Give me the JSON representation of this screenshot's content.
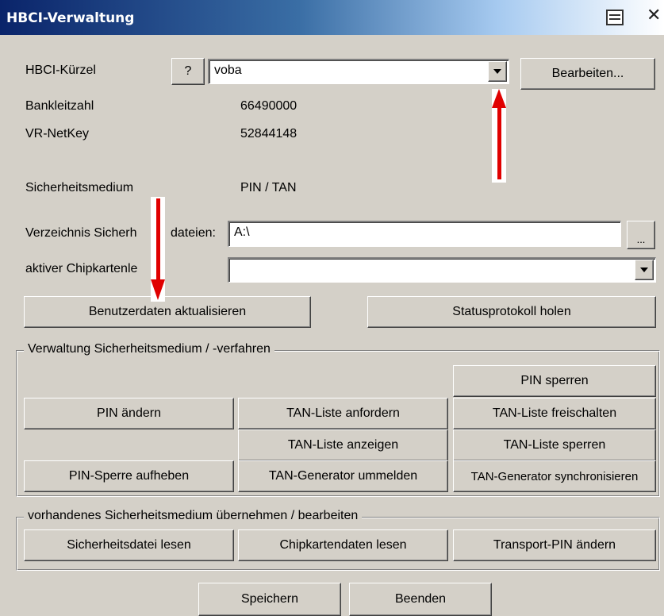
{
  "window": {
    "title": "HBCI-Verwaltung"
  },
  "account": {
    "kuerzel_label": "HBCI-Kürzel",
    "help_label": "?",
    "kuerzel_value": "voba",
    "edit_button": "Bearbeiten...",
    "blz_label": "Bankleitzahl",
    "blz_value": "66490000",
    "netkey_label": "VR-NetKey",
    "netkey_value": "52844148",
    "medium_label": "Sicherheitsmedium",
    "medium_value": "PIN / TAN",
    "dir_label_a": "Verzeichnis Sicherh",
    "dir_label_b": "dateien:",
    "dir_value": "A:\\",
    "browse_label": "...",
    "chip_label": "aktiver Chipkartenle",
    "chip_value": ""
  },
  "actions": {
    "update_user": "Benutzerdaten aktualisieren",
    "status_log": "Statusprotokoll holen"
  },
  "group_medium": {
    "title": "Verwaltung Sicherheitsmedium / -verfahren",
    "pin_sperren": "PIN sperren",
    "pin_aendern": "PIN ändern",
    "tan_anfordern": "TAN-Liste anfordern",
    "tan_freischalten": "TAN-Liste freischalten",
    "tan_anzeigen": "TAN-Liste anzeigen",
    "tan_sperren": "TAN-Liste sperren",
    "pin_sperre_aufheben": "PIN-Sperre aufheben",
    "gen_ummelden": "TAN-Generator ummelden",
    "gen_sync": "TAN-Generator synchronisieren"
  },
  "group_existing": {
    "title": "vorhandenes Sicherheitsmedium übernehmen / bearbeiten",
    "read_file": "Sicherheitsdatei lesen",
    "read_chip": "Chipkartendaten lesen",
    "transport_pin": "Transport-PIN ändern"
  },
  "footer": {
    "save": "Speichern",
    "quit": "Beenden"
  },
  "colors": {
    "annotation_arrow": "#e00000",
    "title_bar": "#0a246a"
  }
}
